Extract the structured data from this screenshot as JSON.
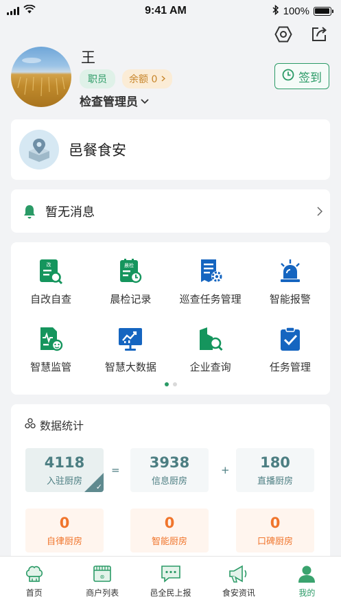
{
  "status_bar": {
    "time": "9:41 AM",
    "battery": "100%",
    "battery_level": 1.0
  },
  "profile": {
    "name": "王",
    "role_badge": "职员",
    "balance_label": "余额 0",
    "role_select": "检查管理员",
    "checkin_label": "签到"
  },
  "brand": {
    "title": "邑餐食安"
  },
  "notice": {
    "text": "暂无消息"
  },
  "menu": {
    "items": [
      {
        "label": "自改自查",
        "icon": "self-inspect-icon"
      },
      {
        "label": "晨检记录",
        "icon": "morning-check-icon"
      },
      {
        "label": "巡查任务管理",
        "icon": "patrol-task-icon"
      },
      {
        "label": "智能报警",
        "icon": "alarm-icon"
      },
      {
        "label": "智慧监管",
        "icon": "smart-supervision-icon"
      },
      {
        "label": "智慧大数据",
        "icon": "big-data-icon"
      },
      {
        "label": "企业查询",
        "icon": "enterprise-search-icon"
      },
      {
        "label": "任务管理",
        "icon": "task-management-icon"
      }
    ],
    "page_indicator": {
      "current": 1,
      "total": 2
    }
  },
  "stats": {
    "title": "数据统计",
    "row1": [
      {
        "value": "4118",
        "label": "入驻厨房"
      },
      {
        "value": "3938",
        "label": "信息厨房"
      },
      {
        "value": "180",
        "label": "直播厨房"
      }
    ],
    "operators": [
      "=",
      "+"
    ],
    "row2": [
      {
        "value": "0",
        "label": "自律厨房"
      },
      {
        "value": "0",
        "label": "智能厨房"
      },
      {
        "value": "0",
        "label": "口碑厨房"
      }
    ]
  },
  "tabbar": {
    "tabs": [
      {
        "label": "首页",
        "icon": "chef-hat-icon"
      },
      {
        "label": "商户列表",
        "icon": "store-icon"
      },
      {
        "label": "邑全民上报",
        "icon": "chat-report-icon"
      },
      {
        "label": "食安资讯",
        "icon": "megaphone-icon"
      },
      {
        "label": "我的",
        "icon": "user-icon"
      }
    ],
    "active": "我的"
  },
  "colors": {
    "primary": "#2a9a66",
    "accent_orange": "#f0752c",
    "stat_teal": "#4c7e82",
    "icon_blue": "#1565c0"
  }
}
